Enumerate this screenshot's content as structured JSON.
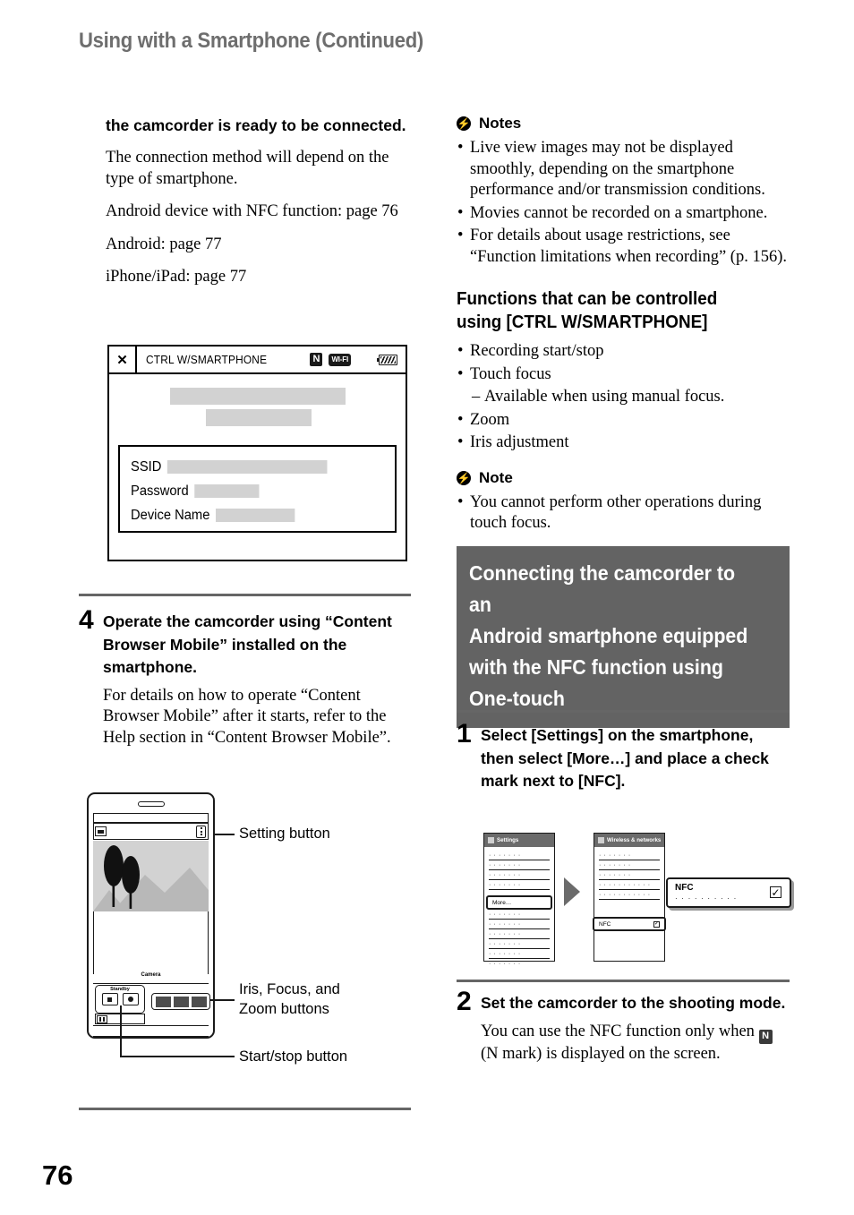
{
  "running_head": "Using with a Smartphone (Continued)",
  "page_number": "76",
  "left_column": {
    "subheading": "the camcorder is ready to be connected.",
    "paragraphs": [
      "The connection method will depend on the type of smartphone.",
      "Android device with NFC function: page 76",
      "Android: page 77",
      "iPhone/iPad: page 77"
    ],
    "camcorder_screen": {
      "close_label": "✕",
      "title": "CTRL W/SMARTPHONE",
      "nfc_icon": "n-mark-icon",
      "wifi_icon_label": "WI-FI",
      "battery_icon": "battery-icon",
      "fields": [
        {
          "label": "SSID",
          "value": ""
        },
        {
          "label": "Password",
          "value": ""
        },
        {
          "label": "Device Name",
          "value": ""
        }
      ]
    },
    "step4": {
      "number": "4",
      "heading": "Operate the camcorder using “Content Browser Mobile” installed on the smartphone.",
      "body": "For details on how to operate “Content Browser Mobile” after it starts, refer to the Help section in “Content Browser Mobile”."
    },
    "phone_diagram": {
      "camera_label": "Camera",
      "standby_label": "Standby",
      "callouts": [
        "Setting button",
        "Iris, Focus, and Zoom buttons",
        "Start/stop button"
      ]
    }
  },
  "right_column": {
    "notes_heading": "Notes",
    "notes": [
      "Live view images may not be displayed smoothly, depending on the smartphone performance and/or transmission conditions.",
      "Movies cannot be recorded on a smartphone.",
      "For details about usage restrictions, see “Function limitations when recording” (p. 156)."
    ],
    "functions_heading": "Functions that can be controlled using [CTRL W/SMARTPHONE]",
    "functions": [
      {
        "text": "Recording start/stop",
        "type": "bullet"
      },
      {
        "text": "Touch focus",
        "type": "bullet"
      },
      {
        "text": "Available when using manual focus.",
        "type": "dash"
      },
      {
        "text": "Zoom",
        "type": "bullet"
      },
      {
        "text": "Iris adjustment",
        "type": "bullet"
      }
    ],
    "note_heading": "Note",
    "note_items": [
      "You cannot perform other operations during touch focus."
    ],
    "banner_lines": [
      "Connecting the camcorder to an",
      "Android smartphone equipped",
      "with the NFC function using",
      "One-touch"
    ],
    "step1": {
      "number": "1",
      "heading": "Select [Settings] on the smartphone, then select [More…] and place a check mark next to [NFC]."
    },
    "android_diagram": {
      "screen1_title": "Settings",
      "screen1_highlight": "More…",
      "screen2_title": "Wireless & networks",
      "screen2_highlight": "NFC",
      "callout_title": "NFC",
      "callout_subtext": "· · · · · · · · · ·",
      "checkbox_mark": "✓"
    },
    "step2": {
      "number": "2",
      "heading": "Set the camcorder to the shooting mode.",
      "body_before": "You can use the NFC function only when",
      "body_after": "(N mark) is displayed on the screen."
    }
  },
  "colors": {
    "runhead_gray": "#6e6e6e",
    "banner_gray": "#636363",
    "placeholder_gray": "#d2d2d2",
    "rule_gray": "#666666"
  }
}
